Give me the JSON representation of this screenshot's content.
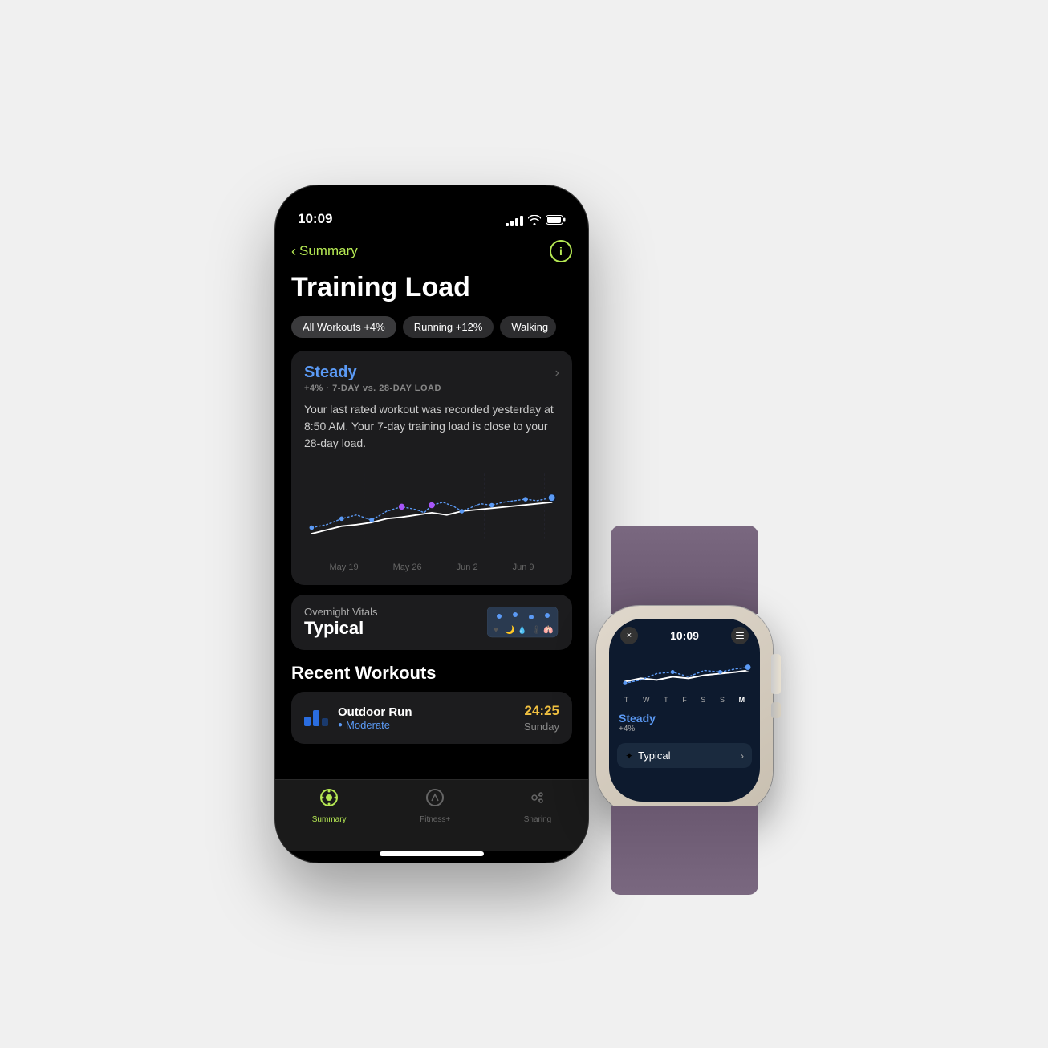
{
  "scene": {
    "background": "#f0f0f0"
  },
  "iphone": {
    "status": {
      "time": "10:09",
      "signal": "●●●●",
      "wifi": "WiFi",
      "battery": "Battery"
    },
    "nav": {
      "back_label": "Summary",
      "info_label": "i"
    },
    "page_title": "Training Load",
    "segments": [
      {
        "label": "All Workouts +4%",
        "active": true
      },
      {
        "label": "Running +12%",
        "active": false
      },
      {
        "label": "Walking",
        "active": false
      }
    ],
    "training_card": {
      "status": "Steady",
      "badge": "+4% · 7-DAY vs. 28-DAY LOAD",
      "description": "Your last rated workout was recorded yesterday at 8:50 AM. Your 7-day training load is close to your 28-day load.",
      "chart_labels": [
        "May 19",
        "May 26",
        "Jun 2",
        "Jun 9"
      ]
    },
    "vitals": {
      "subtitle": "Overnight Vitals",
      "title": "Typical"
    },
    "recent_workouts": {
      "section_title": "Recent Workouts",
      "items": [
        {
          "name": "Outdoor Run",
          "intensity": "Moderate",
          "time": "24:25",
          "day": "Sunday"
        }
      ]
    },
    "tabs": [
      {
        "label": "Summary",
        "active": true
      },
      {
        "label": "Fitness+",
        "active": false
      },
      {
        "label": "Sharing",
        "active": false
      }
    ]
  },
  "watch": {
    "time": "10:09",
    "days": [
      "T",
      "W",
      "T",
      "F",
      "S",
      "S",
      "M"
    ],
    "steady_label": "Steady",
    "steady_sub": "+4%",
    "typical_label": "Typical",
    "close_label": "×",
    "menu_label": "≡"
  }
}
